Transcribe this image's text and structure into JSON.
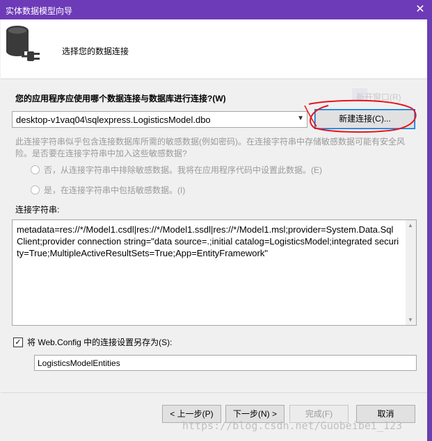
{
  "window": {
    "title": "实体数据模型向导",
    "close_glyph": "✕"
  },
  "header": {
    "title": "选择您的数据连接",
    "icon": "database-plug-icon"
  },
  "question": "您的应用程序应使用哪个数据连接与数据库进行连接?(W)",
  "ghost_text": "新开窗口(R)",
  "connection_select": {
    "value": "desktop-v1vaq04\\sqlexpress.LogisticsModel.dbo"
  },
  "buttons": {
    "new_connection": "新建连接(C)...",
    "prev": "< 上一步(P)",
    "next": "下一步(N) >",
    "finish": "完成(F)",
    "cancel": "取消"
  },
  "sensitive": {
    "description": "此连接字符串似乎包含连接数据库所需的敏感数据(例如密码)。在连接字符串中存储敏感数据可能有安全风险。是否要在连接字符串中加入这些敏感数据?",
    "option_exclude": "否，从连接字符串中排除敏感数据。我将在应用程序代码中设置此数据。(E)",
    "option_include": "是，在连接字符串中包括敏感数据。(I)"
  },
  "connection_string": {
    "label": "连接字符串:",
    "value": "metadata=res://*/Model1.csdl|res://*/Model1.ssdl|res://*/Model1.msl;provider=System.Data.SqlClient;provider connection string=\"data source=.;initial catalog=LogisticsModel;integrated security=True;MultipleActiveResultSets=True;App=EntityFramework\""
  },
  "save_settings": {
    "label": "将 Web.Config 中的连接设置另存为(S):",
    "checked": true,
    "value": "LogisticsModelEntities"
  },
  "watermark": "https://blog.csdn.net/Guobeibei_123",
  "colors": {
    "titlebar": "#6d3bb7",
    "annotation": "#e8141b",
    "focus": "#0078d7"
  }
}
